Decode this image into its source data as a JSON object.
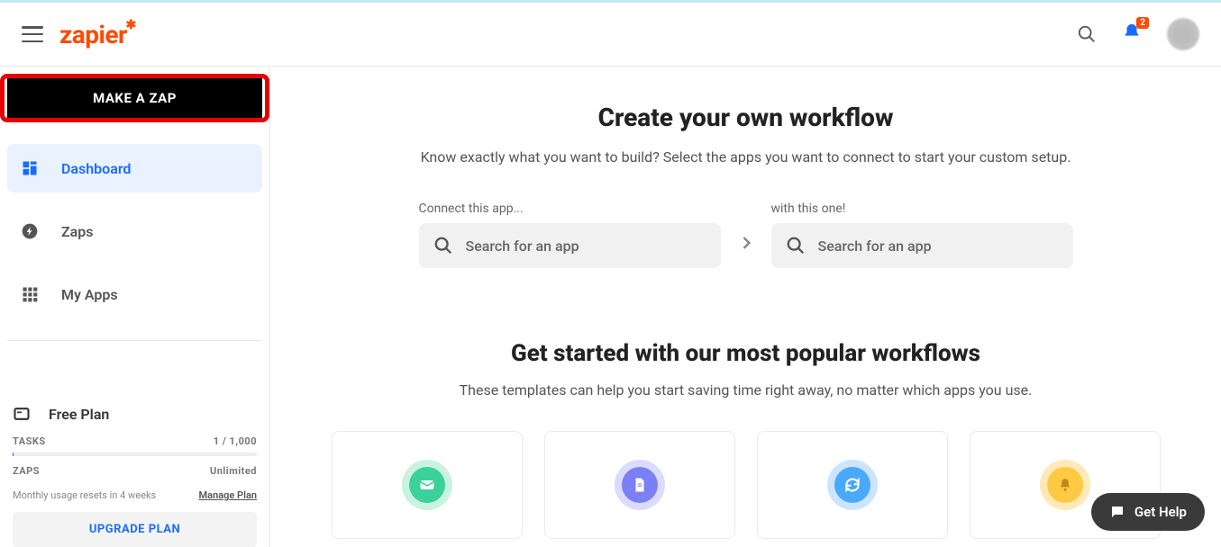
{
  "header": {
    "logo_text": "zapier",
    "notification_count": "2"
  },
  "sidebar": {
    "make_zap_label": "MAKE A ZAP",
    "nav": [
      {
        "label": "Dashboard",
        "icon": "dashboard"
      },
      {
        "label": "Zaps",
        "icon": "bolt"
      },
      {
        "label": "My Apps",
        "icon": "grid"
      }
    ],
    "plan": {
      "name": "Free Plan",
      "tasks_label": "TASKS",
      "tasks_value": "1 / 1,000",
      "zaps_label": "ZAPS",
      "zaps_value": "Unlimited",
      "reset_text": "Monthly usage resets in 4 weeks",
      "manage_label": "Manage Plan",
      "upgrade_label": "UPGRADE PLAN"
    }
  },
  "main": {
    "hero_title": "Create your own workflow",
    "hero_sub": "Know exactly what you want to build? Select the apps you want to connect to start your custom setup.",
    "connect_label_1": "Connect this app...",
    "connect_label_2": "with this one!",
    "search_placeholder": "Search for an app",
    "popular_title": "Get started with our most popular workflows",
    "popular_sub": "These templates can help you start saving time right away, no matter which apps you use."
  },
  "help": {
    "label": "Get Help"
  },
  "card_icons": [
    {
      "outer": "#c9f2e1",
      "inner": "#3ad19b",
      "name": "mail"
    },
    {
      "outer": "#d9dbff",
      "inner": "#7b80f5",
      "name": "doc"
    },
    {
      "outer": "#cce5ff",
      "inner": "#4aa8ff",
      "name": "sync"
    },
    {
      "outer": "#ffe9b8",
      "inner": "#ffc943",
      "name": "bell"
    }
  ]
}
